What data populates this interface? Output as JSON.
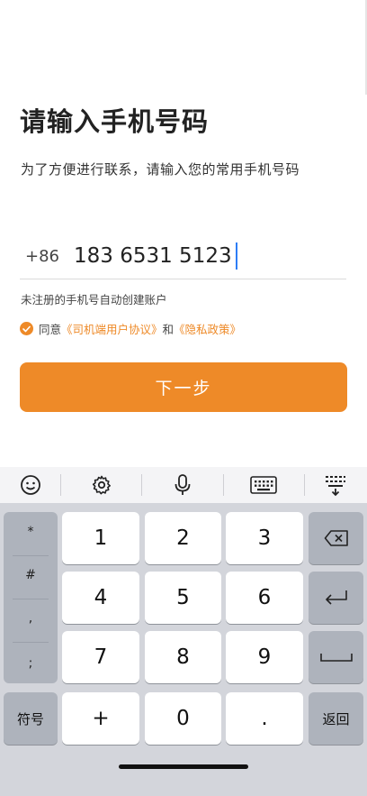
{
  "login": {
    "title": "请输入手机号码",
    "subtitle": "为了方便进行联系，请输入您的常用手机号码",
    "country_code": "+86",
    "phone_value": "183 6531 5123",
    "hint": "未注册的手机号自动创建账户",
    "agree_prefix": "同意",
    "agreement_link": "《司机端用户协议》",
    "agree_and": "和",
    "privacy_link": "《隐私政策》",
    "next_label": "下一步"
  },
  "keyboard": {
    "toolbar_icons": [
      "emoji-icon",
      "gear-icon",
      "microphone-icon",
      "keyboard-icon",
      "keyboard-hide-icon"
    ],
    "symbols": [
      "*",
      "#",
      ",",
      ";"
    ],
    "keys": [
      "1",
      "2",
      "3",
      "4",
      "5",
      "6",
      "7",
      "8",
      "9",
      "0"
    ],
    "plus": "+",
    "dot": ".",
    "symbol_label": "符号",
    "back_label": "返回"
  },
  "colors": {
    "accent": "#ee8a28",
    "cursor": "#2d7df6"
  }
}
